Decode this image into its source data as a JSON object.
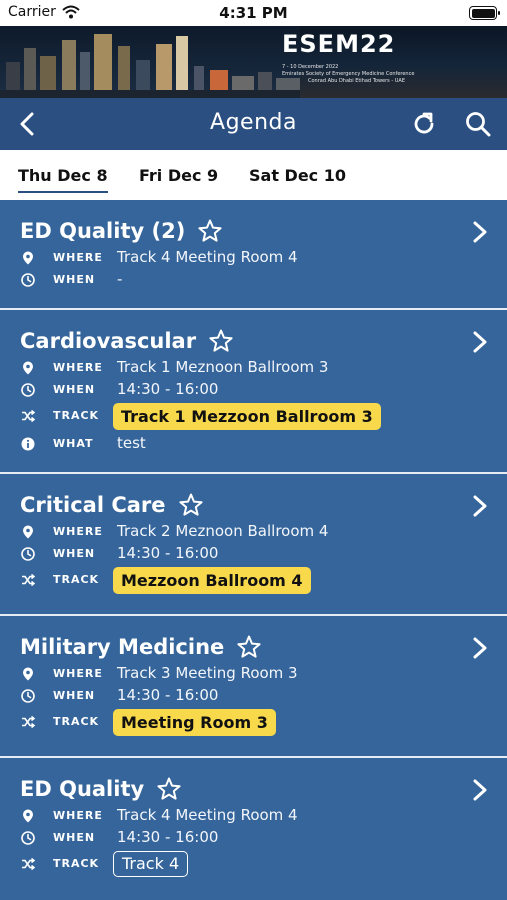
{
  "status": {
    "carrier": "Carrier",
    "time": "4:31 PM",
    "battery_level": 1.0
  },
  "banner": {
    "wordmark": "ESEM22",
    "dates": "7 - 10 December 2022",
    "subtitle": "Emirates Society of Emergency Medicine Conference",
    "venue": "Conrad Abu Dhabi Etihad Towers - UAE"
  },
  "nav": {
    "title": "Agenda",
    "icons": [
      "back-icon",
      "refresh-icon",
      "search-icon"
    ]
  },
  "tabs": [
    {
      "label": "Thu Dec 8",
      "active": true
    },
    {
      "label": "Fri Dec 9",
      "active": false
    },
    {
      "label": "Sat Dec 10",
      "active": false
    }
  ],
  "labels": {
    "where": "WHERE",
    "when": "WHEN",
    "track": "TRACK",
    "what": "WHAT"
  },
  "sessions": [
    {
      "name": "ED Quality (2)",
      "where": "Track 4 Meeting Room 4",
      "when": "-"
    },
    {
      "name": "Cardiovascular",
      "where": "Track 1 Meznoon Ballroom 3",
      "when": "14:30 - 16:00",
      "track": "Track 1 Mezzoon Ballroom 3",
      "what": "test"
    },
    {
      "name": "Critical Care",
      "where": "Track 2 Meznoon Ballroom 4",
      "when": "14:30 - 16:00",
      "track": "Mezzoon Ballroom 4"
    },
    {
      "name": "Military Medicine",
      "where": "Track 3 Meeting Room 3",
      "when": "14:30 - 16:00",
      "track": "Meeting Room 3"
    },
    {
      "name": "ED Quality",
      "where": "Track 4 Meeting Room 4",
      "when": "14:30 - 16:00",
      "track": "Track 4"
    }
  ],
  "colors": {
    "nav_bg": "#2a4f80",
    "card_bg": "#35659a",
    "track_pill": "#f8d94c"
  }
}
